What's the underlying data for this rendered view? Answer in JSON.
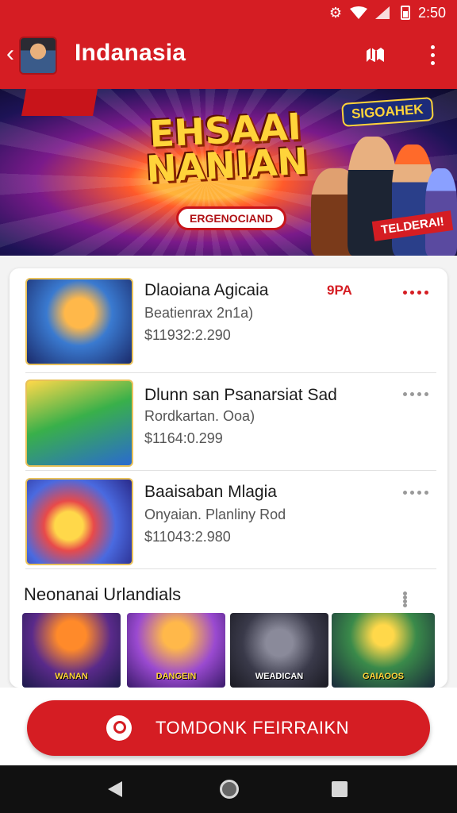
{
  "status": {
    "time": "2:50"
  },
  "appbar": {
    "title": "Indanasia"
  },
  "banner": {
    "headline": "EHSAAI NANIAN",
    "subtitle": "ERGENOCIAND",
    "badge": "SIGOAHEK",
    "tag": "TELDERAI!"
  },
  "list": {
    "items": [
      {
        "title": "Dlaoiana Agicaia",
        "subtitle": "Beatienrax 2n1a)",
        "price": "$11932:2.290",
        "tag": "9PA"
      },
      {
        "title": "Dlunn san Psanarsiat Sad",
        "subtitle": "Rordkartan. Ooa)",
        "price": "$1164:0.299",
        "tag": ""
      },
      {
        "title": "Baaisaban Mlagia",
        "subtitle": "Onyaian. Planliny Rod",
        "price": "$11043:2.980",
        "tag": ""
      }
    ]
  },
  "section": {
    "title": "Neonanai Urlandials",
    "tiles": [
      {
        "label": "WANAN"
      },
      {
        "label": "DANGEIN"
      },
      {
        "label": "WEADICAN"
      },
      {
        "label": "GAIAOOS"
      }
    ]
  },
  "cta": {
    "label": "TOMDONK FEIRRAIKN"
  },
  "colors": {
    "primary": "#d51d23",
    "accent": "#ffd43a"
  },
  "icons": [
    "back-arrow-icon",
    "map-icon",
    "overflow-menu-icon",
    "location-pin-icon",
    "nav-back-icon",
    "nav-home-icon",
    "nav-recents-icon"
  ]
}
